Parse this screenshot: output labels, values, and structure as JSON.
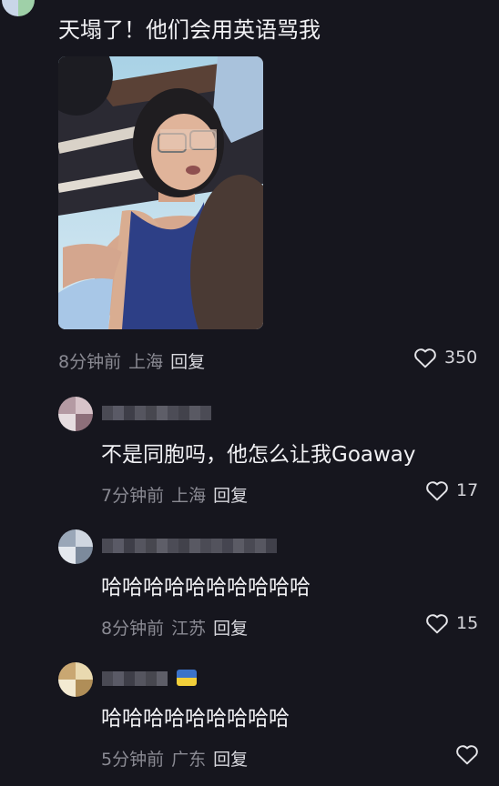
{
  "comments": [
    {
      "text": "天塌了！他们会用英语骂我",
      "time": "8分钟前",
      "location": "上海",
      "reply": "回复",
      "likes": "350"
    },
    {
      "text": "不是同胞吗，他怎么让我Goaway",
      "time": "7分钟前",
      "location": "上海",
      "reply": "回复",
      "likes": "17"
    },
    {
      "text": "哈哈哈哈哈哈哈哈哈哈",
      "time": "8分钟前",
      "location": "江苏",
      "reply": "回复",
      "likes": "15"
    },
    {
      "text": "哈哈哈哈哈哈哈哈哈",
      "time": "5分钟前",
      "location": "广东",
      "reply": "回复",
      "likes": ""
    }
  ],
  "icons": {
    "like": "heart-outline-icon"
  },
  "colors": {
    "background": "#16161e",
    "meta": "#8a8a93"
  }
}
